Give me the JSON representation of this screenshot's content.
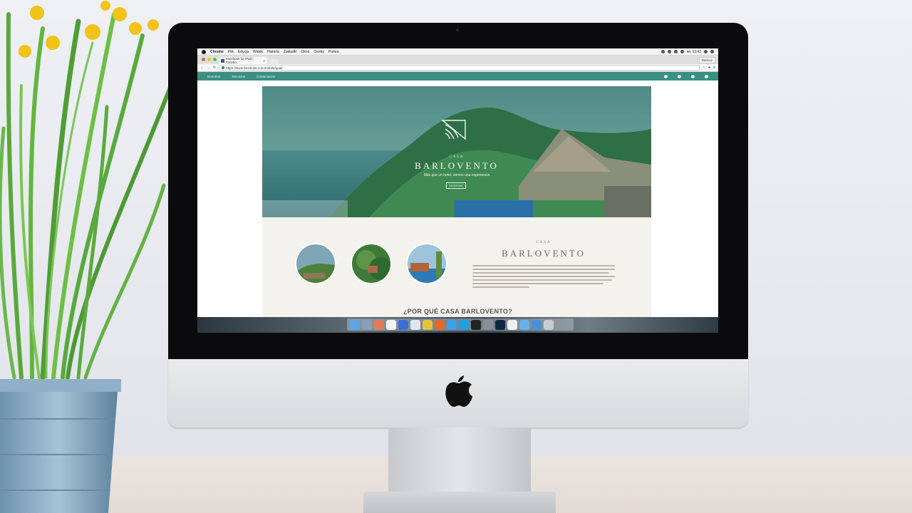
{
  "macos": {
    "menubar": {
      "app": "Chrome",
      "menus": [
        "Plik",
        "Edycja",
        "Widok",
        "Historia",
        "Zakładki",
        "Okno",
        "Osoby",
        "Pomoc"
      ],
      "clock": "wt. 13:42"
    }
  },
  "browser": {
    "tab_title": "Facebook for iPad | Facebo",
    "profile": "Dariusz",
    "url": "https://www.facebook.com/mobile/ipad/"
  },
  "site": {
    "nav": [
      "Nosotros",
      "Servicios",
      "Contactanos"
    ],
    "hero": {
      "casa": "CASA",
      "title": "BARLOVENTO",
      "subtitle": "Más que un hotel, somos una experiencia",
      "button": "RESERVAR"
    },
    "about": {
      "casa": "CASA",
      "title": "BARLOVENTO"
    },
    "why_heading": "¿POR QUÉ CASA BARLOVENTO?"
  },
  "colors": {
    "site_nav": "#3a8f82",
    "about_bg": "#f4f2ec"
  },
  "dock_icons": [
    "finder-icon",
    "launchpad-icon",
    "photos-icon",
    "calendar-icon",
    "app-store-icon",
    "cloud-icon",
    "chrome-icon",
    "firefox-icon",
    "safari-icon",
    "skype-icon",
    "terminal-icon",
    "system-preferences-icon",
    "photoshop-icon",
    "document-icon",
    "folder-icon",
    "downloads-icon",
    "trash-icon"
  ]
}
